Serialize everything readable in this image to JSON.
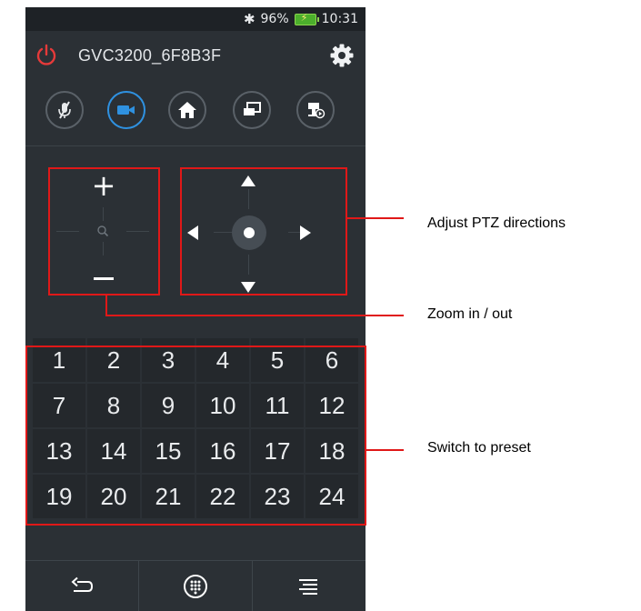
{
  "status_bar": {
    "battery": "96%",
    "time": "10:31"
  },
  "header": {
    "device_name": "GVC3200_6F8B3F"
  },
  "mode_buttons": [
    {
      "icon": "mic-muted-icon",
      "active": false
    },
    {
      "icon": "video-camera-icon",
      "active": true
    },
    {
      "icon": "home-icon",
      "active": false
    },
    {
      "icon": "display-icon",
      "active": false
    },
    {
      "icon": "camera-preset-icon",
      "active": false
    }
  ],
  "zoom": {
    "plus_label": "+",
    "minus_label": "—"
  },
  "presets": [
    "1",
    "2",
    "3",
    "4",
    "5",
    "6",
    "7",
    "8",
    "9",
    "10",
    "11",
    "12",
    "13",
    "14",
    "15",
    "16",
    "17",
    "18",
    "19",
    "20",
    "21",
    "22",
    "23",
    "24"
  ],
  "annotations": {
    "ptz": "Adjust PTZ directions",
    "zoom": "Zoom in / out",
    "preset": "Switch to preset"
  },
  "colors": {
    "background": "#2b3035",
    "accent": "#2f91e0",
    "power": "#e53a3a",
    "annotation": "#e01818"
  }
}
